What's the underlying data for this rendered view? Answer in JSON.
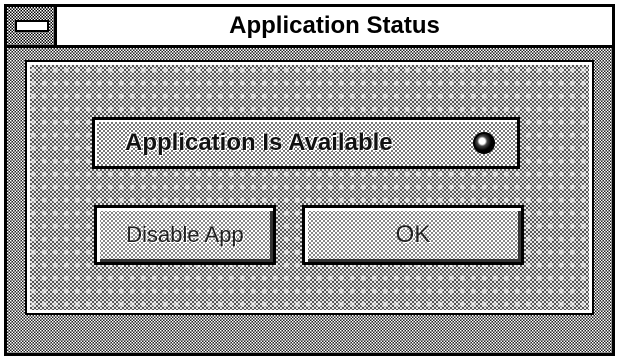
{
  "window": {
    "title": "Application Status"
  },
  "status": {
    "text": "Application Is Available",
    "indicator_icon": "status-led-icon"
  },
  "buttons": {
    "disable_label": "Disable App",
    "ok_label": "OK"
  }
}
